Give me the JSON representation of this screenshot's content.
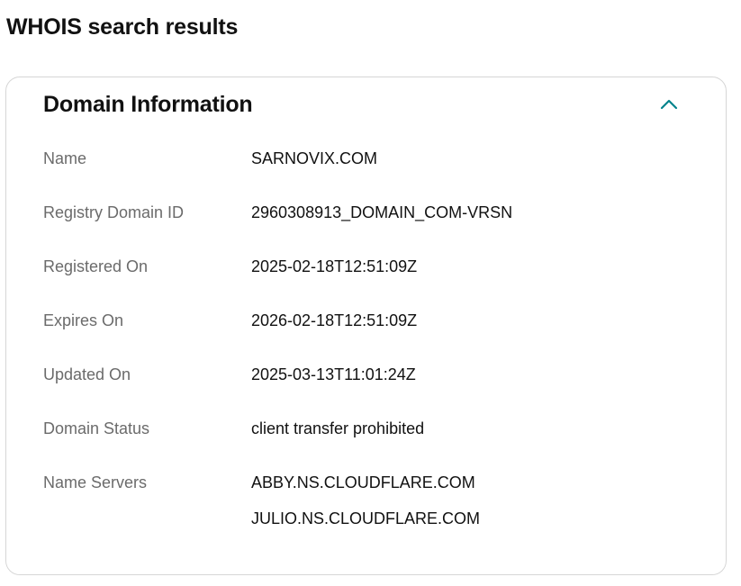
{
  "page": {
    "title": "WHOIS search results"
  },
  "card": {
    "title": "Domain Information",
    "collapse_icon": "chevron-up-icon",
    "accent_color": "#00838c",
    "rows": [
      {
        "label": "Name",
        "value": "SARNOVIX.COM"
      },
      {
        "label": "Registry Domain ID",
        "value": "2960308913_DOMAIN_COM-VRSN"
      },
      {
        "label": "Registered On",
        "value": "2025-02-18T12:51:09Z"
      },
      {
        "label": "Expires On",
        "value": "2026-02-18T12:51:09Z"
      },
      {
        "label": "Updated On",
        "value": "2025-03-13T11:01:24Z"
      },
      {
        "label": "Domain Status",
        "value": "client transfer prohibited"
      }
    ],
    "name_servers": {
      "label": "Name Servers",
      "values": [
        "ABBY.NS.CLOUDFLARE.COM",
        "JULIO.NS.CLOUDFLARE.COM"
      ]
    }
  }
}
